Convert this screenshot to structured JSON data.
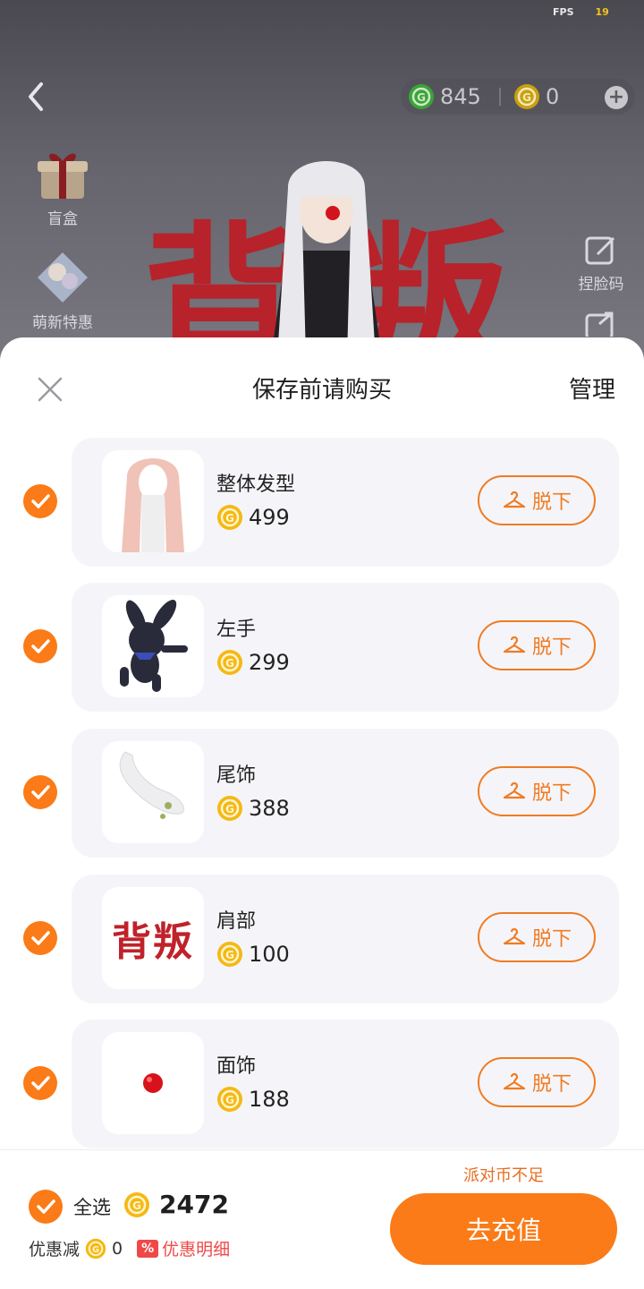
{
  "status": {
    "fps_label": "FPS",
    "fps_value": "19"
  },
  "currency": {
    "green_amount": "845",
    "gold_amount": "0"
  },
  "side_menu": {
    "blind_box_label": "盲盒",
    "newbie_label": "萌新特惠"
  },
  "right_menu": {
    "face_code_label": "捏脸码"
  },
  "scene_text": {
    "char1": "背",
    "char2": "叛"
  },
  "sheet": {
    "title": "保存前请购买",
    "manage_label": "管理"
  },
  "items": [
    {
      "name": "整体发型",
      "price": "499",
      "action": "脱下"
    },
    {
      "name": "左手",
      "price": "299",
      "action": "脱下"
    },
    {
      "name": "尾饰",
      "price": "388",
      "action": "脱下"
    },
    {
      "name": "肩部",
      "price": "100",
      "action": "脱下"
    },
    {
      "name": "面饰",
      "price": "188",
      "action": "脱下"
    }
  ],
  "shoulder_art_text": "背叛",
  "footer": {
    "select_all_label": "全选",
    "total": "2472",
    "discount_label": "优惠减",
    "discount_value": "0",
    "discount_tag": "%",
    "discount_detail_label": "优惠明细",
    "insufficient_text": "派对币不足",
    "recharge_label": "去充值"
  },
  "colors": {
    "accent": "#fa7b17",
    "coin": "#f5b814",
    "warning": "#f04848"
  }
}
